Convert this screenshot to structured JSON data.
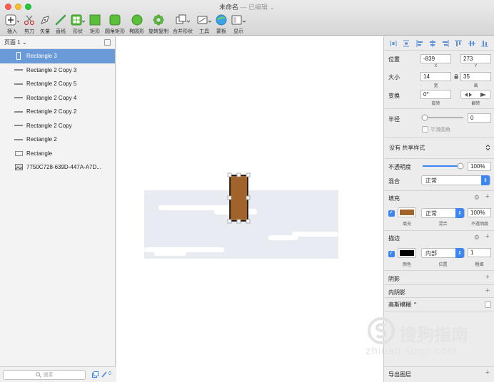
{
  "window": {
    "title": "未命名",
    "subtitle": "— 已编辑 ⌄"
  },
  "toolbar": [
    {
      "name": "insert",
      "label": "插入"
    },
    {
      "name": "scissors",
      "label": "剪刀"
    },
    {
      "name": "vector",
      "label": "矢量"
    },
    {
      "name": "line",
      "label": "直线"
    },
    {
      "name": "shape",
      "label": "形状"
    },
    {
      "name": "rectangle",
      "label": "矩形"
    },
    {
      "name": "rounded-rect",
      "label": "圆角矩形"
    },
    {
      "name": "oval",
      "label": "椭圆形"
    },
    {
      "name": "rotate-copy",
      "label": "旋转复制"
    },
    {
      "name": "combine",
      "label": "合并形状"
    },
    {
      "name": "tools",
      "label": "工具"
    },
    {
      "name": "artboard",
      "label": "蒙板"
    },
    {
      "name": "display",
      "label": "显示"
    }
  ],
  "pages": {
    "current": "页面 1 ⌄"
  },
  "layers": [
    {
      "label": "Rectangle 3",
      "selected": true,
      "icon": "vertical-rect"
    },
    {
      "label": "Rectangle 2 Copy 3",
      "icon": "line"
    },
    {
      "label": "Rectangle 2 Copy 5",
      "icon": "line"
    },
    {
      "label": "Rectangle 2 Copy 4",
      "icon": "line"
    },
    {
      "label": "Rectangle 2 Copy 2",
      "icon": "line"
    },
    {
      "label": "Rectangle 2 Copy",
      "icon": "line"
    },
    {
      "label": "Rectangle 2",
      "icon": "line"
    },
    {
      "label": "Rectangle",
      "icon": "rect"
    },
    {
      "label": "7750C728-639D-447A-A7D...",
      "icon": "image"
    }
  ],
  "search": {
    "placeholder": "搜索",
    "count": "0"
  },
  "inspector": {
    "position": {
      "label": "位置",
      "x": "-839",
      "y": "273",
      "x_label": "X",
      "y_label": "Y"
    },
    "size": {
      "label": "大小",
      "w": "14",
      "h": "35",
      "w_label": "宽",
      "h_label": "高"
    },
    "transform": {
      "label": "变换",
      "rotate": "0°",
      "rotate_label": "旋转",
      "flip_label": "翻转"
    },
    "radius": {
      "label": "半径",
      "value": "0",
      "smooth_label": "平滑圆角"
    },
    "shared_style": "没有 共享样式",
    "opacity": {
      "label": "不透明度",
      "value": "100%"
    },
    "blend": {
      "label": "混合",
      "value": "正常"
    },
    "fill": {
      "section": "填充",
      "color": "#a0632b",
      "blend": "正常",
      "opacity": "100%",
      "color_label": "填充",
      "blend_label": "混合",
      "opacity_label": "不透明度"
    },
    "border": {
      "section": "描边",
      "color": "#000000",
      "position": "内部",
      "width": "1",
      "color_label": "颜色",
      "position_label": "位置",
      "width_label": "粗细"
    },
    "shadow": "阴影",
    "inner_shadow": "内阴影",
    "blur": "高斯模糊 ⌃",
    "export": "导出图层"
  },
  "watermark": {
    "brand": "搜狗指南",
    "url": "zhinan.sogo.com"
  },
  "colors": {
    "selection": "#6a9bd8",
    "accent": "#3b86f0",
    "fill": "#a0632b",
    "ground": "#e9ebf3"
  }
}
